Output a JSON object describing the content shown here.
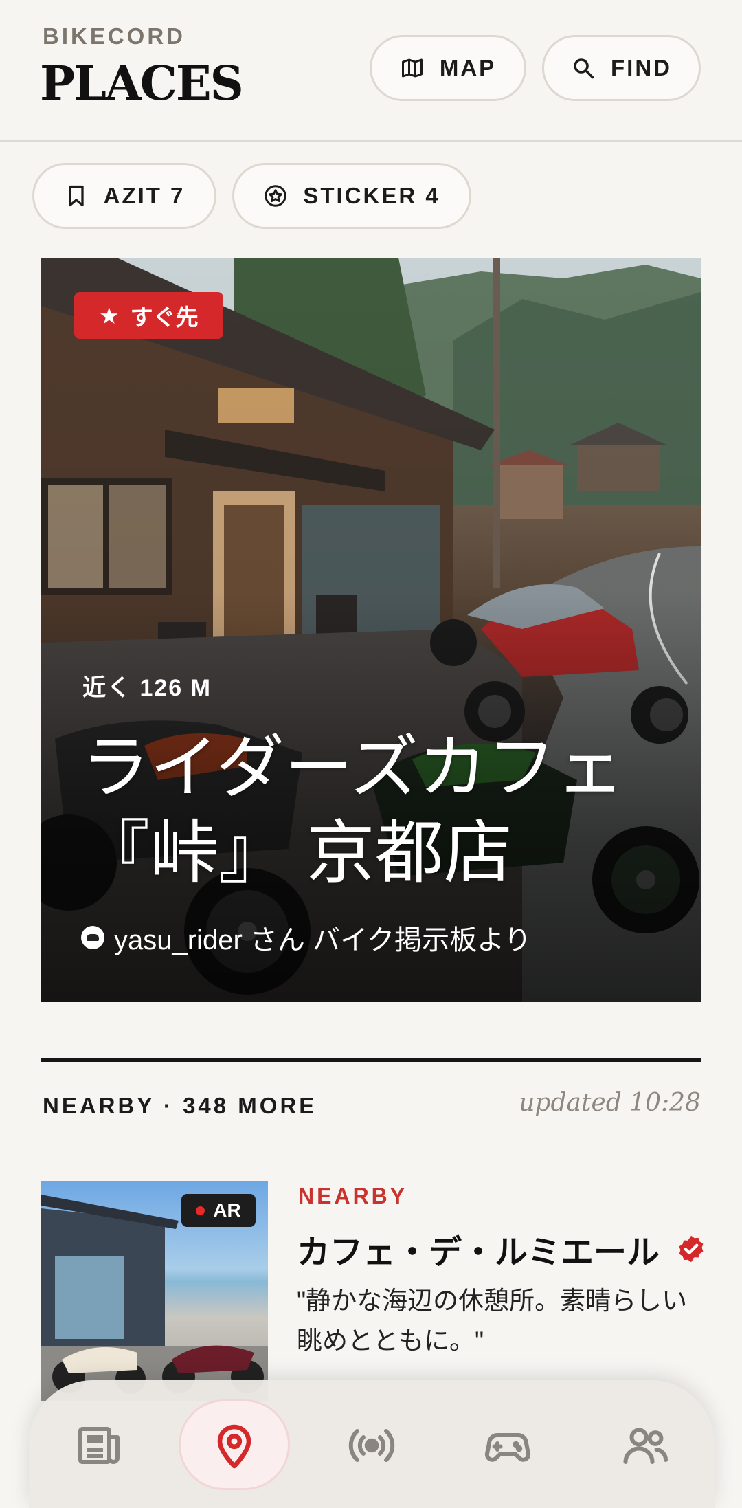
{
  "header": {
    "brand": "BIKECORD",
    "title": "PLACES",
    "map_label": "MAP",
    "find_label": "FIND"
  },
  "filters": {
    "azit_label": "AZIT 7",
    "sticker_label": "STICKER 4"
  },
  "hero": {
    "badge": "すぐ先",
    "distance": "近く 126 M",
    "title_line1": "ライダーズカフェ",
    "title_line2": "『峠』 京都店",
    "source": "yasu_rider さん バイク掲示板より"
  },
  "nearby": {
    "label": "NEARBY · 348 MORE",
    "updated": "updated 10:28"
  },
  "card": {
    "ar_badge": "AR",
    "tag": "NEARBY",
    "title": "カフェ・デ・ルミエール",
    "description": "\"静かな海辺の休憩所。素晴らしい眺めとともに。\""
  },
  "colors": {
    "accent": "#d4282a",
    "background": "#f6f5f2",
    "text": "#1b1b1b"
  },
  "tabs": [
    {
      "icon": "newspaper-icon",
      "active": false
    },
    {
      "icon": "map-pin-icon",
      "active": true
    },
    {
      "icon": "broadcast-icon",
      "active": false
    },
    {
      "icon": "gamepad-icon",
      "active": false
    },
    {
      "icon": "users-icon",
      "active": false
    }
  ]
}
